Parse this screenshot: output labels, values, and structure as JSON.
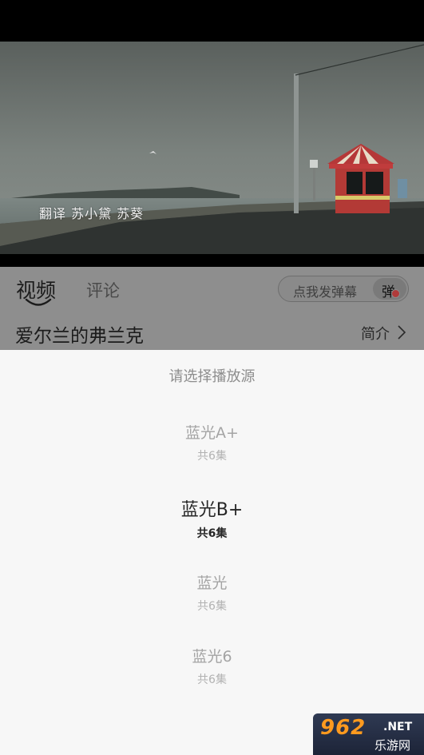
{
  "video": {
    "subtitle": "翻译   苏小黛  苏葵"
  },
  "tabs": {
    "video": "视频",
    "comments": "评论"
  },
  "danmaku": {
    "placeholder": "点我发弹幕",
    "toggle_label": "弹"
  },
  "show": {
    "title": "爱尔兰的弗兰克",
    "intro_label": "简介"
  },
  "source_picker": {
    "title": "请选择播放源",
    "options": [
      {
        "name": "蓝光A+",
        "count": "共6集",
        "selected": false
      },
      {
        "name": "蓝光B+",
        "count": "共6集",
        "selected": true
      },
      {
        "name": "蓝光",
        "count": "共6集",
        "selected": false
      },
      {
        "name": "蓝光6",
        "count": "共6集",
        "selected": false
      }
    ]
  },
  "watermark": {
    "logo": "962",
    "net": ".NET",
    "site": "乐游网"
  }
}
